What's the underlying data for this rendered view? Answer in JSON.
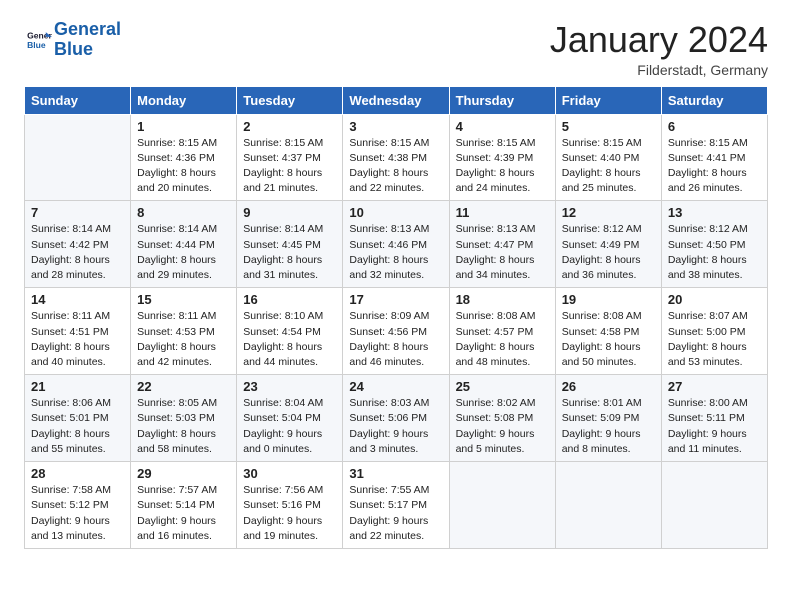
{
  "header": {
    "logo_line1": "General",
    "logo_line2": "Blue",
    "month": "January 2024",
    "location": "Filderstadt, Germany"
  },
  "weekdays": [
    "Sunday",
    "Monday",
    "Tuesday",
    "Wednesday",
    "Thursday",
    "Friday",
    "Saturday"
  ],
  "weeks": [
    [
      {
        "day": "",
        "info": ""
      },
      {
        "day": "1",
        "info": "Sunrise: 8:15 AM\nSunset: 4:36 PM\nDaylight: 8 hours\nand 20 minutes."
      },
      {
        "day": "2",
        "info": "Sunrise: 8:15 AM\nSunset: 4:37 PM\nDaylight: 8 hours\nand 21 minutes."
      },
      {
        "day": "3",
        "info": "Sunrise: 8:15 AM\nSunset: 4:38 PM\nDaylight: 8 hours\nand 22 minutes."
      },
      {
        "day": "4",
        "info": "Sunrise: 8:15 AM\nSunset: 4:39 PM\nDaylight: 8 hours\nand 24 minutes."
      },
      {
        "day": "5",
        "info": "Sunrise: 8:15 AM\nSunset: 4:40 PM\nDaylight: 8 hours\nand 25 minutes."
      },
      {
        "day": "6",
        "info": "Sunrise: 8:15 AM\nSunset: 4:41 PM\nDaylight: 8 hours\nand 26 minutes."
      }
    ],
    [
      {
        "day": "7",
        "info": "Sunrise: 8:14 AM\nSunset: 4:42 PM\nDaylight: 8 hours\nand 28 minutes."
      },
      {
        "day": "8",
        "info": "Sunrise: 8:14 AM\nSunset: 4:44 PM\nDaylight: 8 hours\nand 29 minutes."
      },
      {
        "day": "9",
        "info": "Sunrise: 8:14 AM\nSunset: 4:45 PM\nDaylight: 8 hours\nand 31 minutes."
      },
      {
        "day": "10",
        "info": "Sunrise: 8:13 AM\nSunset: 4:46 PM\nDaylight: 8 hours\nand 32 minutes."
      },
      {
        "day": "11",
        "info": "Sunrise: 8:13 AM\nSunset: 4:47 PM\nDaylight: 8 hours\nand 34 minutes."
      },
      {
        "day": "12",
        "info": "Sunrise: 8:12 AM\nSunset: 4:49 PM\nDaylight: 8 hours\nand 36 minutes."
      },
      {
        "day": "13",
        "info": "Sunrise: 8:12 AM\nSunset: 4:50 PM\nDaylight: 8 hours\nand 38 minutes."
      }
    ],
    [
      {
        "day": "14",
        "info": "Sunrise: 8:11 AM\nSunset: 4:51 PM\nDaylight: 8 hours\nand 40 minutes."
      },
      {
        "day": "15",
        "info": "Sunrise: 8:11 AM\nSunset: 4:53 PM\nDaylight: 8 hours\nand 42 minutes."
      },
      {
        "day": "16",
        "info": "Sunrise: 8:10 AM\nSunset: 4:54 PM\nDaylight: 8 hours\nand 44 minutes."
      },
      {
        "day": "17",
        "info": "Sunrise: 8:09 AM\nSunset: 4:56 PM\nDaylight: 8 hours\nand 46 minutes."
      },
      {
        "day": "18",
        "info": "Sunrise: 8:08 AM\nSunset: 4:57 PM\nDaylight: 8 hours\nand 48 minutes."
      },
      {
        "day": "19",
        "info": "Sunrise: 8:08 AM\nSunset: 4:58 PM\nDaylight: 8 hours\nand 50 minutes."
      },
      {
        "day": "20",
        "info": "Sunrise: 8:07 AM\nSunset: 5:00 PM\nDaylight: 8 hours\nand 53 minutes."
      }
    ],
    [
      {
        "day": "21",
        "info": "Sunrise: 8:06 AM\nSunset: 5:01 PM\nDaylight: 8 hours\nand 55 minutes."
      },
      {
        "day": "22",
        "info": "Sunrise: 8:05 AM\nSunset: 5:03 PM\nDaylight: 8 hours\nand 58 minutes."
      },
      {
        "day": "23",
        "info": "Sunrise: 8:04 AM\nSunset: 5:04 PM\nDaylight: 9 hours\nand 0 minutes."
      },
      {
        "day": "24",
        "info": "Sunrise: 8:03 AM\nSunset: 5:06 PM\nDaylight: 9 hours\nand 3 minutes."
      },
      {
        "day": "25",
        "info": "Sunrise: 8:02 AM\nSunset: 5:08 PM\nDaylight: 9 hours\nand 5 minutes."
      },
      {
        "day": "26",
        "info": "Sunrise: 8:01 AM\nSunset: 5:09 PM\nDaylight: 9 hours\nand 8 minutes."
      },
      {
        "day": "27",
        "info": "Sunrise: 8:00 AM\nSunset: 5:11 PM\nDaylight: 9 hours\nand 11 minutes."
      }
    ],
    [
      {
        "day": "28",
        "info": "Sunrise: 7:58 AM\nSunset: 5:12 PM\nDaylight: 9 hours\nand 13 minutes."
      },
      {
        "day": "29",
        "info": "Sunrise: 7:57 AM\nSunset: 5:14 PM\nDaylight: 9 hours\nand 16 minutes."
      },
      {
        "day": "30",
        "info": "Sunrise: 7:56 AM\nSunset: 5:16 PM\nDaylight: 9 hours\nand 19 minutes."
      },
      {
        "day": "31",
        "info": "Sunrise: 7:55 AM\nSunset: 5:17 PM\nDaylight: 9 hours\nand 22 minutes."
      },
      {
        "day": "",
        "info": ""
      },
      {
        "day": "",
        "info": ""
      },
      {
        "day": "",
        "info": ""
      }
    ]
  ]
}
